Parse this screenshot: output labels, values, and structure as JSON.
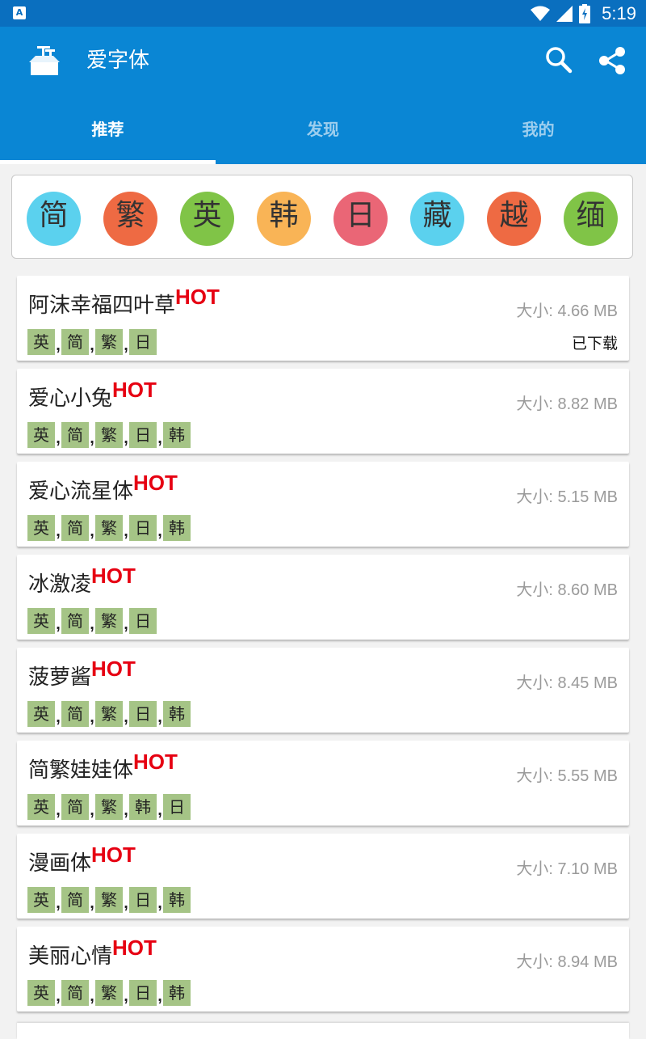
{
  "status_bar": {
    "app_icon_letter": "A",
    "time": "5:19",
    "icons": [
      "wifi-icon",
      "cell-signal-icon",
      "battery-charging-icon"
    ]
  },
  "app": {
    "title": "爱字体",
    "icons": [
      "app-logo-icon",
      "search-icon",
      "share-icon"
    ]
  },
  "tabs": [
    {
      "label": "推荐",
      "active": true
    },
    {
      "label": "发现",
      "active": false
    },
    {
      "label": "我的",
      "active": false
    }
  ],
  "languages": [
    {
      "label": "简",
      "color": "#5bd1ee"
    },
    {
      "label": "繁",
      "color": "#ee6a43"
    },
    {
      "label": "英",
      "color": "#80c447"
    },
    {
      "label": "韩",
      "color": "#f9b456"
    },
    {
      "label": "日",
      "color": "#ea6676"
    },
    {
      "label": "藏",
      "color": "#5bd1ee"
    },
    {
      "label": "越",
      "color": "#ee6a43"
    },
    {
      "label": "缅",
      "color": "#80c447"
    }
  ],
  "fonts": [
    {
      "name": "阿沫幸福四叶草",
      "hot": "HOT",
      "size": "大小: 4.66 MB",
      "status": "已下载",
      "tags": [
        "英",
        "简",
        "繁",
        "日"
      ]
    },
    {
      "name": "爱心小兔",
      "hot": "HOT",
      "size": "大小: 8.82 MB",
      "status": "",
      "tags": [
        "英",
        "简",
        "繁",
        "日",
        "韩"
      ]
    },
    {
      "name": "爱心流星体",
      "hot": "HOT",
      "size": "大小: 5.15 MB",
      "status": "",
      "tags": [
        "英",
        "简",
        "繁",
        "日",
        "韩"
      ]
    },
    {
      "name": "冰激凌",
      "hot": "HOT",
      "size": "大小: 8.60 MB",
      "status": "",
      "tags": [
        "英",
        "简",
        "繁",
        "日"
      ]
    },
    {
      "name": "菠萝酱",
      "hot": "HOT",
      "size": "大小: 8.45 MB",
      "status": "",
      "tags": [
        "英",
        "简",
        "繁",
        "日",
        "韩"
      ]
    },
    {
      "name": "简繁娃娃体",
      "hot": "HOT",
      "size": "大小: 5.55 MB",
      "status": "",
      "tags": [
        "英",
        "简",
        "繁",
        "韩",
        "日"
      ]
    },
    {
      "name": "漫画体",
      "hot": "HOT",
      "size": "大小: 7.10 MB",
      "status": "",
      "tags": [
        "英",
        "简",
        "繁",
        "日",
        "韩"
      ]
    },
    {
      "name": "美丽心情",
      "hot": "HOT",
      "size": "大小: 8.94 MB",
      "status": "",
      "tags": [
        "英",
        "简",
        "繁",
        "日",
        "韩"
      ]
    }
  ],
  "tag_separator": ","
}
